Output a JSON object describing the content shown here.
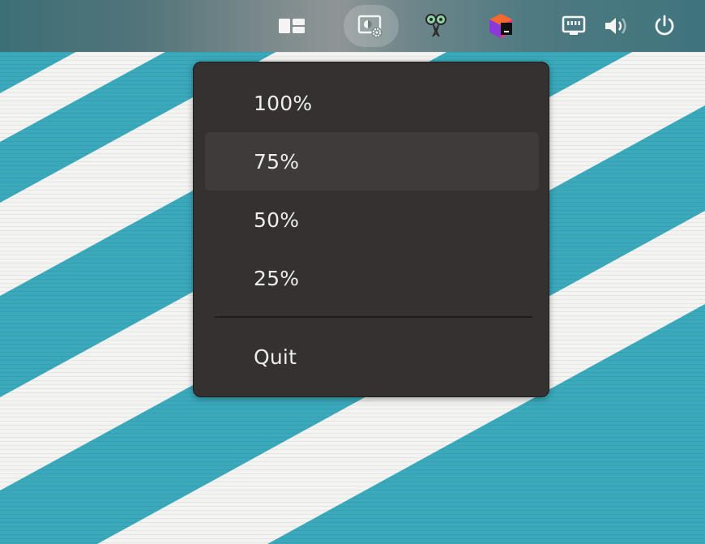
{
  "topbar": {
    "icons": [
      {
        "name": "tiling-layout-icon",
        "active": false
      },
      {
        "name": "display-brightness-settings-icon",
        "active": true
      },
      {
        "name": "screenshot-scissors-icon",
        "active": false
      },
      {
        "name": "colorful-cube-app-icon",
        "active": false
      },
      {
        "name": "wired-network-icon",
        "active": false
      },
      {
        "name": "volume-icon",
        "active": false
      },
      {
        "name": "power-icon",
        "active": false
      }
    ]
  },
  "menu": {
    "items": [
      {
        "label": "100%",
        "highlighted": false
      },
      {
        "label": "75%",
        "highlighted": true
      },
      {
        "label": "50%",
        "highlighted": false
      },
      {
        "label": "25%",
        "highlighted": false
      }
    ],
    "quit_label": "Quit"
  },
  "colors": {
    "wallpaper_teal": "#3aa9bb",
    "wallpaper_white": "#f3f3f1",
    "menu_bg": "#353131",
    "menu_hover": "#3f3b3b",
    "menu_text": "#ededed",
    "topbar_left": "#3d6f77",
    "topbar_center": "#8f9596"
  }
}
